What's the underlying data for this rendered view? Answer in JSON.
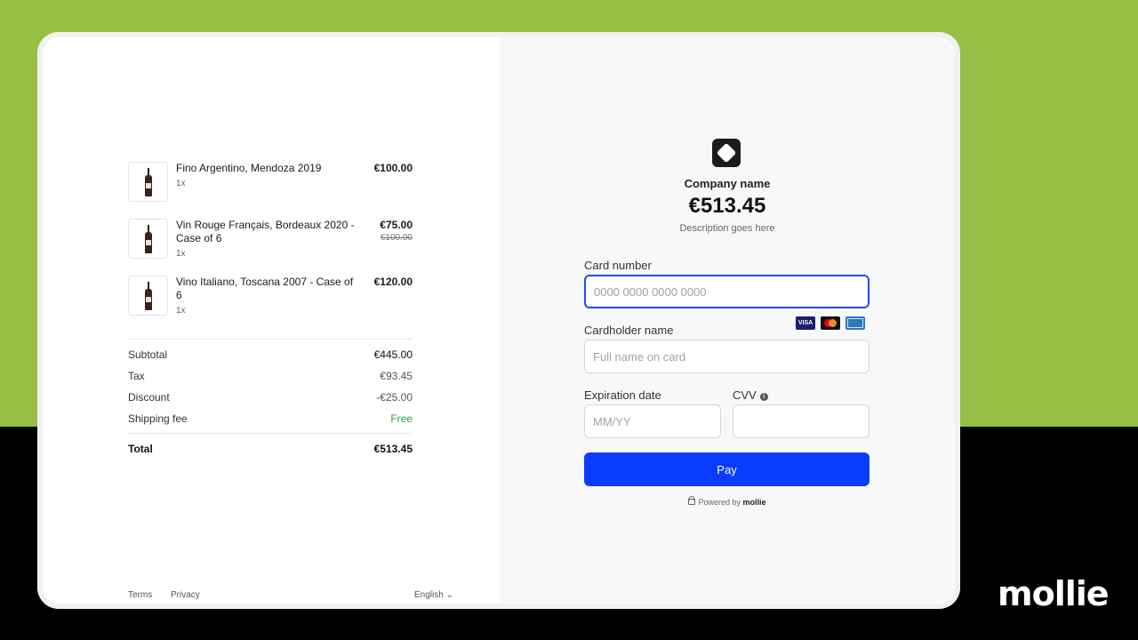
{
  "brand": "mollie",
  "order": {
    "items": [
      {
        "name": "Fino Argentino, Mendoza 2019",
        "qty": "1x",
        "price": "€100.00",
        "old_price": ""
      },
      {
        "name": "Vin Rouge Français, Bordeaux 2020 - Case of 6",
        "qty": "1x",
        "price": "€75.00",
        "old_price": "€100.00"
      },
      {
        "name": "Vino Italiano, Toscana 2007 - Case of 6",
        "qty": "1x",
        "price": "€120.00",
        "old_price": ""
      }
    ],
    "summary": {
      "subtotal_label": "Subtotal",
      "subtotal": "€445.00",
      "tax_label": "Tax",
      "tax": "€93.45",
      "discount_label": "Discount",
      "discount": "-€25.00",
      "shipping_label": "Shipping fee",
      "shipping": "Free",
      "total_label": "Total",
      "total": "€513.45"
    },
    "footer": {
      "terms": "Terms",
      "privacy": "Privacy",
      "language": "English ⌄"
    }
  },
  "payment": {
    "company": "Company name",
    "amount": "€513.45",
    "description": "Description goes here",
    "card_number_label": "Card number",
    "card_number_placeholder": "0000 0000 0000 0000",
    "card_brands": [
      "VISA",
      "Mastercard",
      "American Express"
    ],
    "cardholder_label": "Cardholder name",
    "cardholder_placeholder": "Full name on card",
    "expiry_label": "Expiration date",
    "expiry_placeholder": "MM/YY",
    "cvv_label": "CVV",
    "pay_label": "Pay",
    "powered_by": "Powered by",
    "powered_brand": "mollie"
  },
  "colors": {
    "accent": "#0a3cff",
    "background_top": "#95c045",
    "free": "#2e9e3a"
  }
}
